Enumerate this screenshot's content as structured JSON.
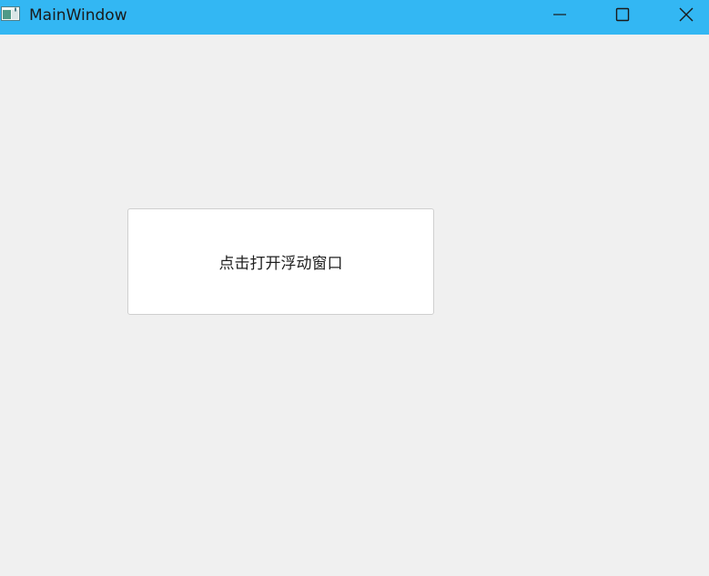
{
  "window": {
    "title": "MainWindow",
    "titlebar_color": "#33b7f3",
    "background_color": "#f0f0f0",
    "icons": {
      "app": "app-window-icon",
      "minimize": "minimize-icon",
      "maximize": "maximize-icon",
      "close": "close-icon"
    }
  },
  "main": {
    "open_float_button_label": "点击打开浮动窗口"
  }
}
